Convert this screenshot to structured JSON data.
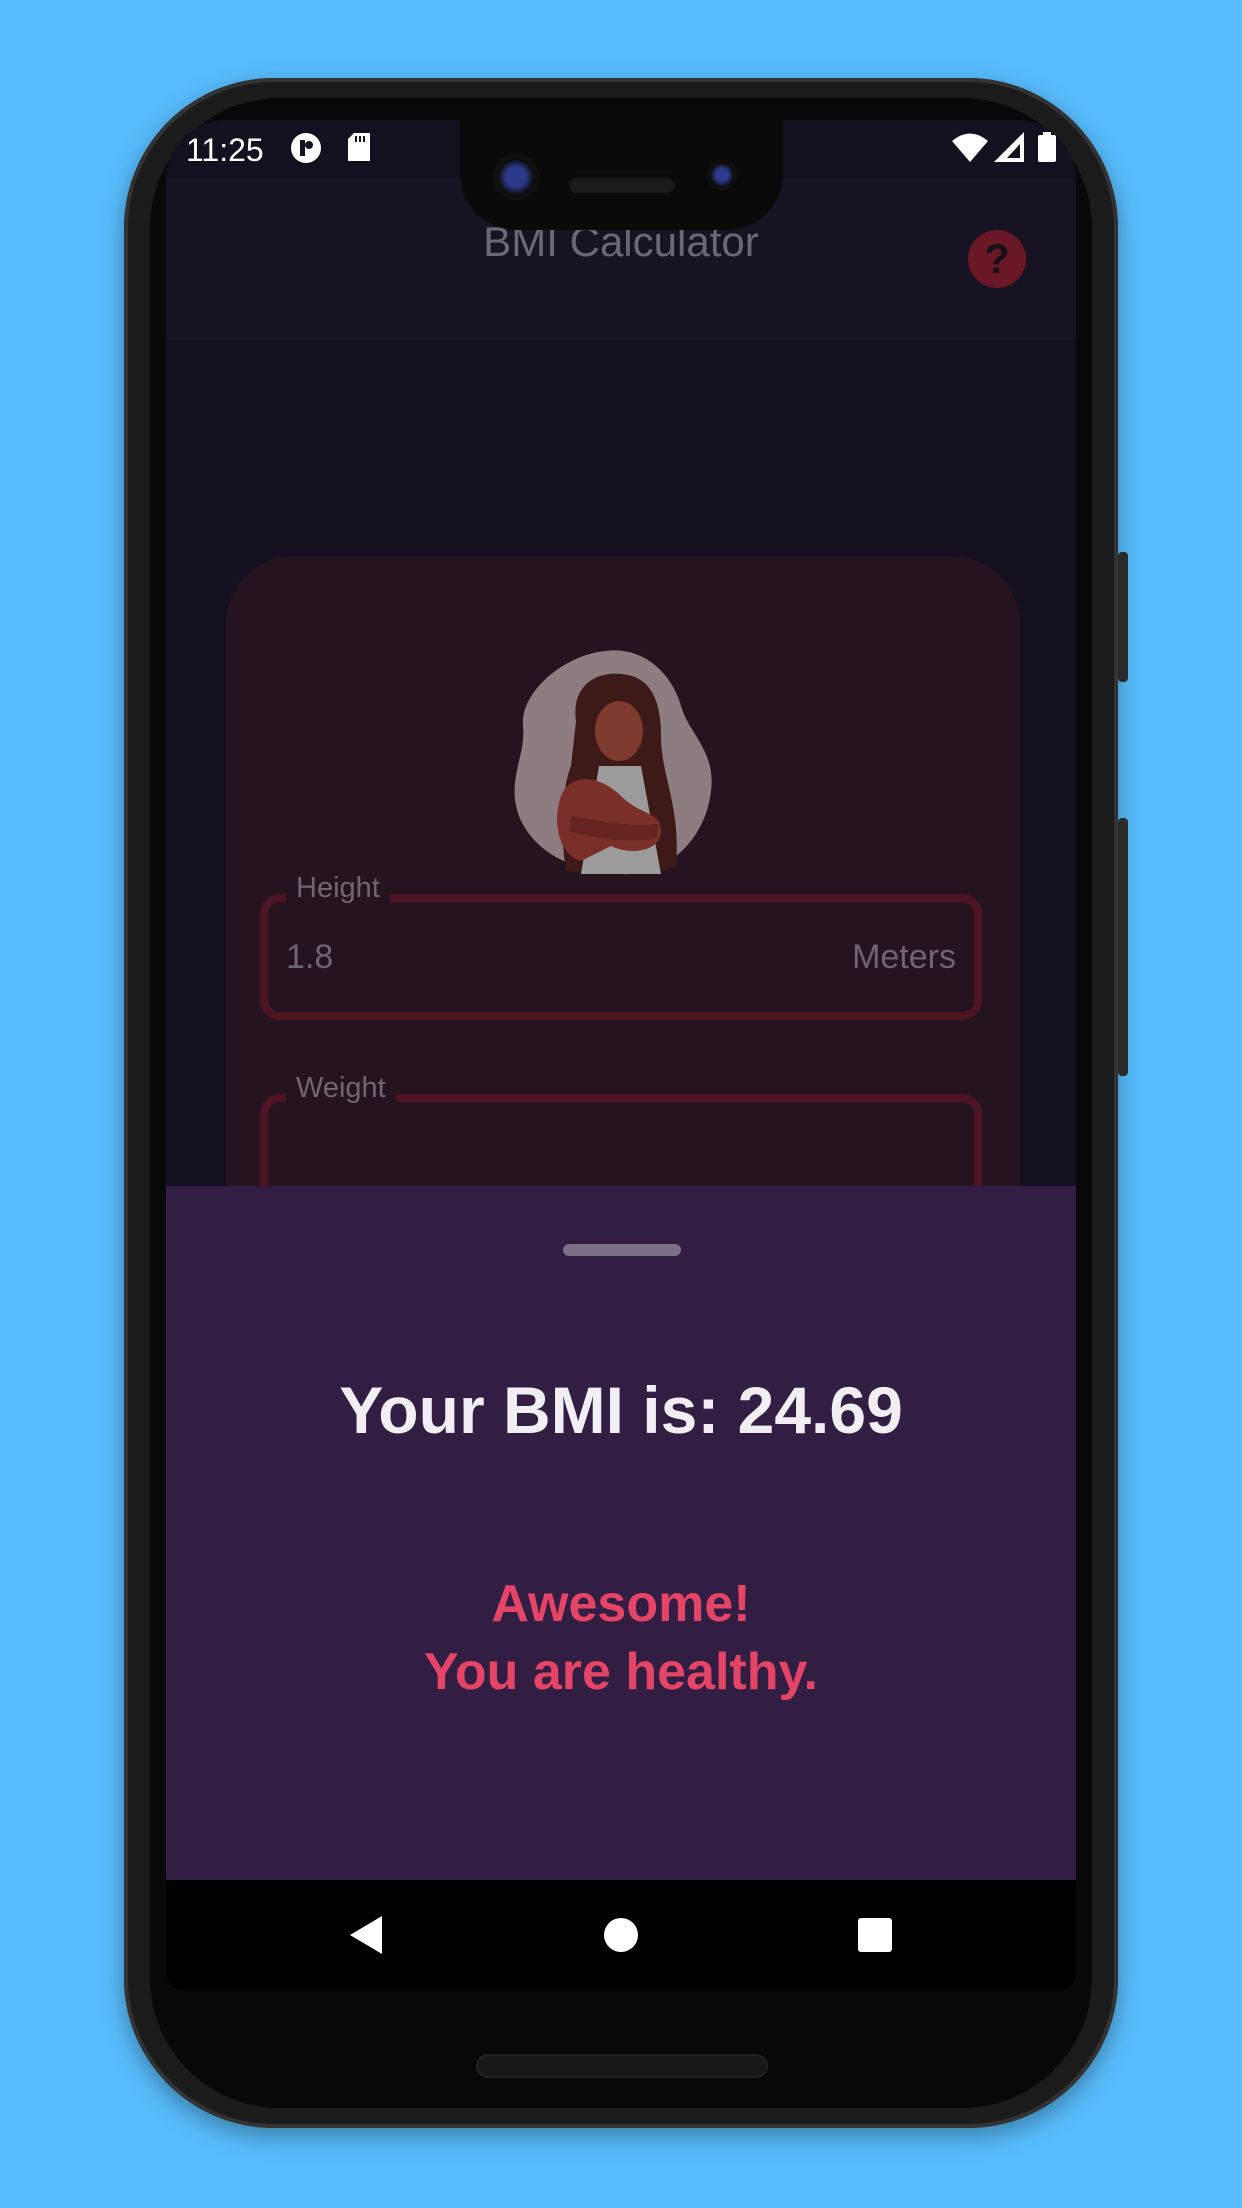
{
  "status_bar": {
    "time": "11:25",
    "left_icons": [
      "app-notification-icon",
      "sd-card-icon"
    ],
    "right_icons": [
      "wifi-icon",
      "signal-icon",
      "battery-icon"
    ]
  },
  "app_bar": {
    "title": "BMI Calculator",
    "help_icon": "?"
  },
  "form": {
    "height": {
      "label": "Height",
      "value": "1.8",
      "unit": "Meters"
    },
    "weight": {
      "label": "Weight"
    }
  },
  "result_sheet": {
    "bmi_text": "Your BMI is: 24.69",
    "verdict_line1": "Awesome!",
    "verdict_line2": "You are healthy."
  },
  "colors": {
    "background": "#58bdfd",
    "sheet": "#311e42",
    "accent": "#e44466",
    "card": "#25131f"
  }
}
